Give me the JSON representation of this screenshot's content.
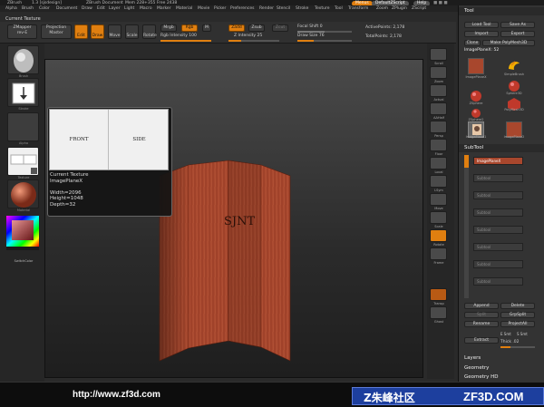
{
  "titlebar": {
    "app": "ZBrush",
    "version": "1.3 [sjsdesign]",
    "document": "ZBrush Document",
    "stats": "Mem 228+355  Free 2438",
    "menus_pill": "Menus",
    "script_pill": "DefaultZScript",
    "help_pill": "Help"
  },
  "menubar": {
    "items": [
      "Alpha",
      "Brush",
      "Color",
      "Document",
      "Draw",
      "Edit",
      "Layer",
      "Light",
      "Macro",
      "Marker",
      "Material",
      "Movie",
      "Picker",
      "Preferences",
      "Render",
      "Stencil",
      "Stroke",
      "Texture",
      "Tool",
      "Transform",
      "Zoom",
      "ZPlugin",
      "ZScript"
    ]
  },
  "current_texture_label": "Current Texture",
  "toolbar": {
    "zmapper": "ZMapper",
    "zmapper_sub": "rev-E",
    "projection": "Projection",
    "projection_sub": "Master",
    "edit": "Edit",
    "draw": "Draw",
    "move": "Move",
    "scale": "Scale",
    "rotate": "Rotate",
    "mrgb": "Mrgb",
    "rgb": "Rgb",
    "m": "M",
    "rgb_intensity": "Rgb Intensity 100",
    "zadd": "Zadd",
    "zsub": "Zsub",
    "zcut": "Zcut",
    "z_intensity": "Z Intensity 25",
    "focal_shift": "Focal Shift 0",
    "draw_size": "Draw Size 76",
    "active_points": "ActivePoints: 2,178",
    "total_points": "TotalPoints: 2,178",
    "rgb_intensity_value": 1.0,
    "z_intensity_value": 0.25,
    "draw_size_value": 0.3
  },
  "left_shelf": {
    "labels": [
      "Brush",
      "Stroke",
      "Alpha",
      "Texture",
      "Material"
    ],
    "switch_color": "SwitchColor"
  },
  "popup": {
    "front": "FRONT",
    "side": "SIDE",
    "info": "Current Texture\nImagePlaneX\n\nWidth=2096\nHeight=1048\nDepth=32"
  },
  "model_text": "SJNT",
  "right_shelf": {
    "labels": [
      "Scroll",
      "Zoom",
      "Actual",
      "AAHalf",
      "Persp",
      "Floor",
      "Local",
      "LSym",
      "Move",
      "Scale",
      "Rotate",
      "Frame",
      "Transp",
      "Ghost"
    ]
  },
  "tool_panel": {
    "title": "Tool",
    "load": "Load Tool",
    "save": "Save As",
    "import": "Import",
    "export": "Export",
    "clone": "Clone",
    "make_polymesh": "Make PolyMesh3D",
    "current_tool": "ImagePlaneX: 52",
    "tools": [
      "ImagePlaneX",
      "SimpleBrush",
      "Sphere3D",
      "ZSphere",
      "PolyMesh3D",
      "ZSphere2",
      "ImagePlane1",
      "ImagePlane2"
    ],
    "subtool": "SubTool",
    "subtool_item": "ImagePlaneX",
    "subtool_empty": "Subtool",
    "append": "Append",
    "delete": "Delete",
    "split": "Split",
    "grp_split": "GrpSplit",
    "rename": "Rename",
    "project_all": "ProjectAll",
    "extract": "Extract",
    "esmt": "E Smt",
    "ssmt": "S Smt",
    "thick": "Thick .02",
    "layers": "Layers",
    "geometry": "Geometry",
    "geometry_hd": "Geometry HD"
  },
  "footer": {
    "url": "http://www.zf3d.com",
    "logo_cn": "Z朱峰社区",
    "logo_en": "ZF3D.COM"
  },
  "colors": {
    "accent": "#e07f10",
    "wood": "#a8472d"
  }
}
